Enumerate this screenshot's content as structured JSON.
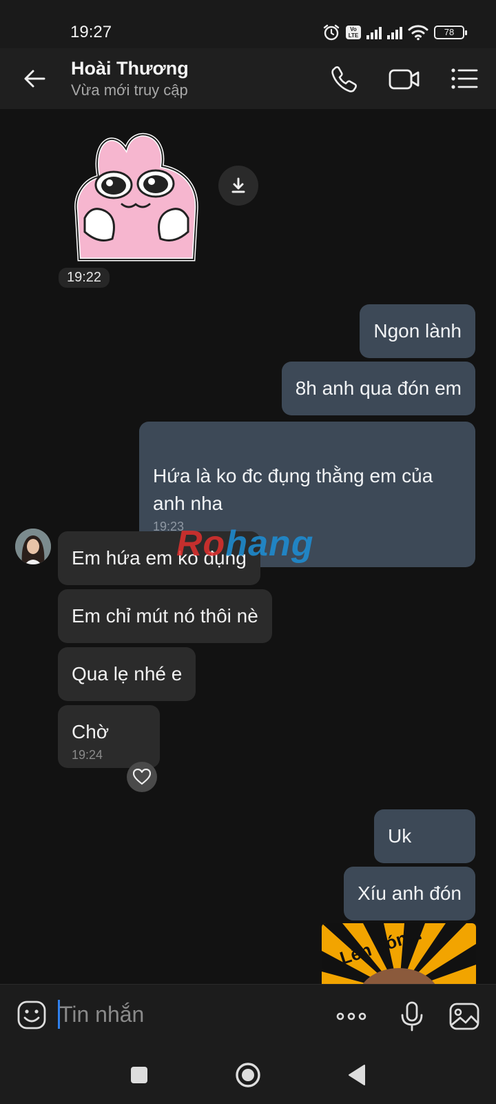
{
  "status_bar": {
    "time": "19:27",
    "volte": "Vo LTE",
    "battery": "78"
  },
  "header": {
    "name": "Hoài Thương",
    "subtitle": "Vừa mới truy cập"
  },
  "messages": {
    "sticker_time": "19:22",
    "out1": "Ngon lành",
    "out2": "8h anh qua đón em",
    "out3": "Hứa là ko đc đụng thằng em của\nanh nha",
    "out3_time": "19:23",
    "in1": "Em hứa em ko đụng",
    "in2": "Em chỉ mút nó thôi nè",
    "in3": "Qua lẹ nhé e",
    "in4": "Chờ",
    "in4_time": "19:24",
    "out4": "Uk",
    "out5": "Xíu anh đón",
    "image_caption": "Lên đón..."
  },
  "watermark": {
    "part1": "Ro",
    "part2": "hang"
  },
  "composer": {
    "placeholder": "Tin nhắn"
  },
  "colors": {
    "accent": "#2f80ed",
    "outgoing_bubble": "#3d4957",
    "incoming_bubble": "#2b2b2b",
    "background": "#121212"
  }
}
